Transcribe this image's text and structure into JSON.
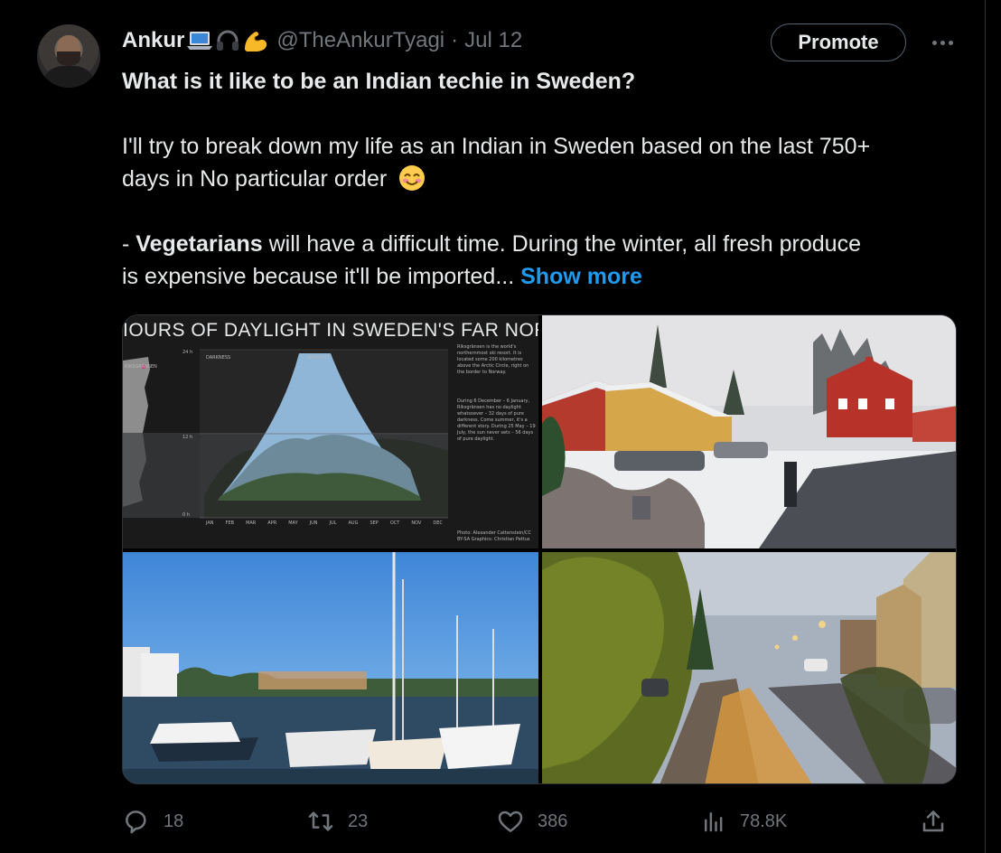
{
  "tweet": {
    "author_name": "Ankur",
    "handle": "@TheAnkurTyagi",
    "separator": "·",
    "date": "Jul 12",
    "promote_label": "Promote",
    "headline": "What is it like to be an Indian techie in Sweden?",
    "para1_line1": "I'll try to break down my life as an Indian in Sweden based on the last 750+",
    "para1_line2": "days in No particular order",
    "bullet_dash": "- ",
    "bullet_bold": "Vegetarians",
    "bullet_rest": " will have a difficult time. During the winter, all fresh produce",
    "bullet_line2": "is expensive because it'll be imported...",
    "show_more": "Show more"
  },
  "media": {
    "chart_title": "IOURS OF DAYLIGHT IN SWEDEN'S FAR NORTI",
    "chart_side_label": "RIKSGRÄNSEN",
    "chart_darkness_label": "DARKNESS",
    "chart_daylight_label": "DAYLIGHT",
    "chart_ticks": [
      "24 h",
      "12 h",
      "0 h"
    ],
    "chart_note_1": "Riksgränsen is the world's northernmost ski resort. It is located some 200 kilometres above the Arctic Circle, right on the border to Norway.",
    "chart_note_2": "During 6 December – 6 January, Riksgränsen has no daylight whatsoever – 32 days of pure darkness. Come summer, it's a different story. During 25 May – 19 July, the sun never sets – 56 days of pure daylight.",
    "chart_credit": "Photo: Alexander Cattenstein/CC BY-SA Graphics: Christian Pettus",
    "months": [
      "JAN",
      "FEB",
      "MAR",
      "APR",
      "MAY",
      "JUN",
      "JUL",
      "AUG",
      "SEP",
      "OCT",
      "NOV",
      "DEC"
    ]
  },
  "actions": {
    "replies": "18",
    "reposts": "23",
    "likes": "386",
    "views": "78.8K"
  },
  "colors": {
    "background": "#000000",
    "text": "#e7e9ea",
    "muted": "#71767b",
    "link": "#1d9bf0",
    "border": "#2f3336"
  }
}
